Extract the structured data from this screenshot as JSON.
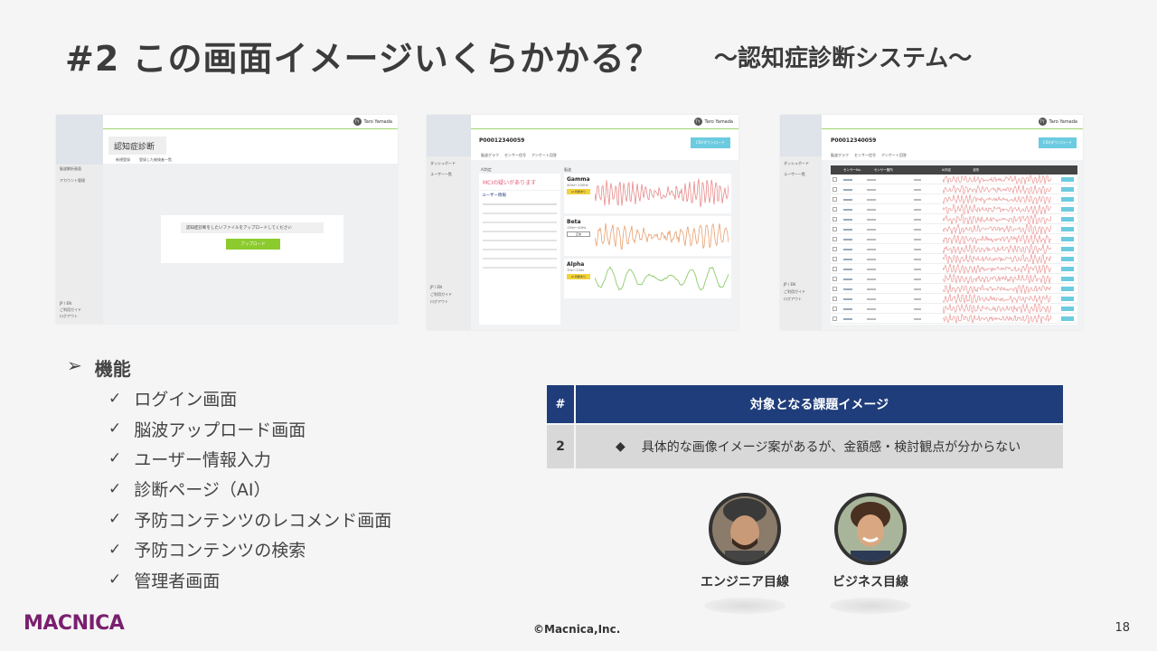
{
  "title": "#2 この画面イメージいくらかかる？",
  "subtitle": "～認知症診断システム～",
  "mock1": {
    "user": "Taro Yamada",
    "avatar": "TY",
    "page_title": "認知症診断",
    "tabs": [
      "新規登録",
      "登録した被検者一覧"
    ],
    "side_items": [
      "脳波解析画面",
      "アカウント管理"
    ],
    "side_bottom": [
      "JP / EN",
      "ご利用ガイド",
      "ログアウト"
    ],
    "upload_prompt": "認知症診断をしたいファイルをアップロードしてください",
    "upload_button": "アップロード"
  },
  "mock2": {
    "user": "Taro Yamada",
    "avatar": "TY",
    "patient_id": "P00012340059",
    "csv_button": "CSVダウンロード",
    "tabs": [
      "脳波グラフ",
      "センサー信号",
      "アンケート回答"
    ],
    "side_items": [
      "ダッシュボード",
      "ユーザー一覧"
    ],
    "side_bottom": [
      "JP / EN",
      "ご利用ガイド",
      "ログアウト"
    ],
    "ai_label": "AI判定",
    "ai_result": "MCIの疑いがあります",
    "user_info_label": "ユーザー情報",
    "wave_label": "脳波",
    "waves": [
      {
        "name": "Gamma",
        "range": "40Hz〜100Hz",
        "badge": "AI 判断あり",
        "color": "#e88a8a"
      },
      {
        "name": "Beta",
        "range": "13Hz〜40Hz",
        "badge": "正常",
        "color": "#e8a070"
      },
      {
        "name": "Alpha",
        "range": "7Hz〜13Hz",
        "badge": "AI 判断あり",
        "color": "#8ccb6a"
      }
    ]
  },
  "mock3": {
    "user": "Taro Yamada",
    "avatar": "TY",
    "patient_id": "P00012340059",
    "csv_button": "CSVダウンロード",
    "tabs": [
      "脳波グラフ",
      "センサー信号",
      "アンケート回答"
    ],
    "side_items": [
      "ダッシュボード",
      "ユーザー一覧"
    ],
    "side_bottom": [
      "JP / EN",
      "ご利用ガイド",
      "ログアウト"
    ],
    "columns": [
      "センサーNo.",
      "センサー箇所",
      "AI判定",
      "波形"
    ]
  },
  "features": {
    "heading": "機能",
    "bullet": "➢",
    "check": "✓",
    "items": [
      "ログイン画面",
      "脳波アップロード画面",
      "ユーザー情報入力",
      "診断ページ（AI）",
      "予防コンテンツのレコメンド画面",
      "予防コンテンツの検索",
      "管理者画面"
    ]
  },
  "table": {
    "header_num": "#",
    "header_title": "対象となる課題イメージ",
    "rows": [
      {
        "num": "2",
        "bullet": "◆",
        "text": "具体的な画像イメージ案があるが、金額感・検討観点が分からない"
      }
    ]
  },
  "personas": [
    {
      "label": "エンジニア目線"
    },
    {
      "label": "ビジネス目線"
    }
  ],
  "footer": {
    "logo": "MACNICA",
    "copyright": "©Macnica,Inc.",
    "page": "18"
  }
}
